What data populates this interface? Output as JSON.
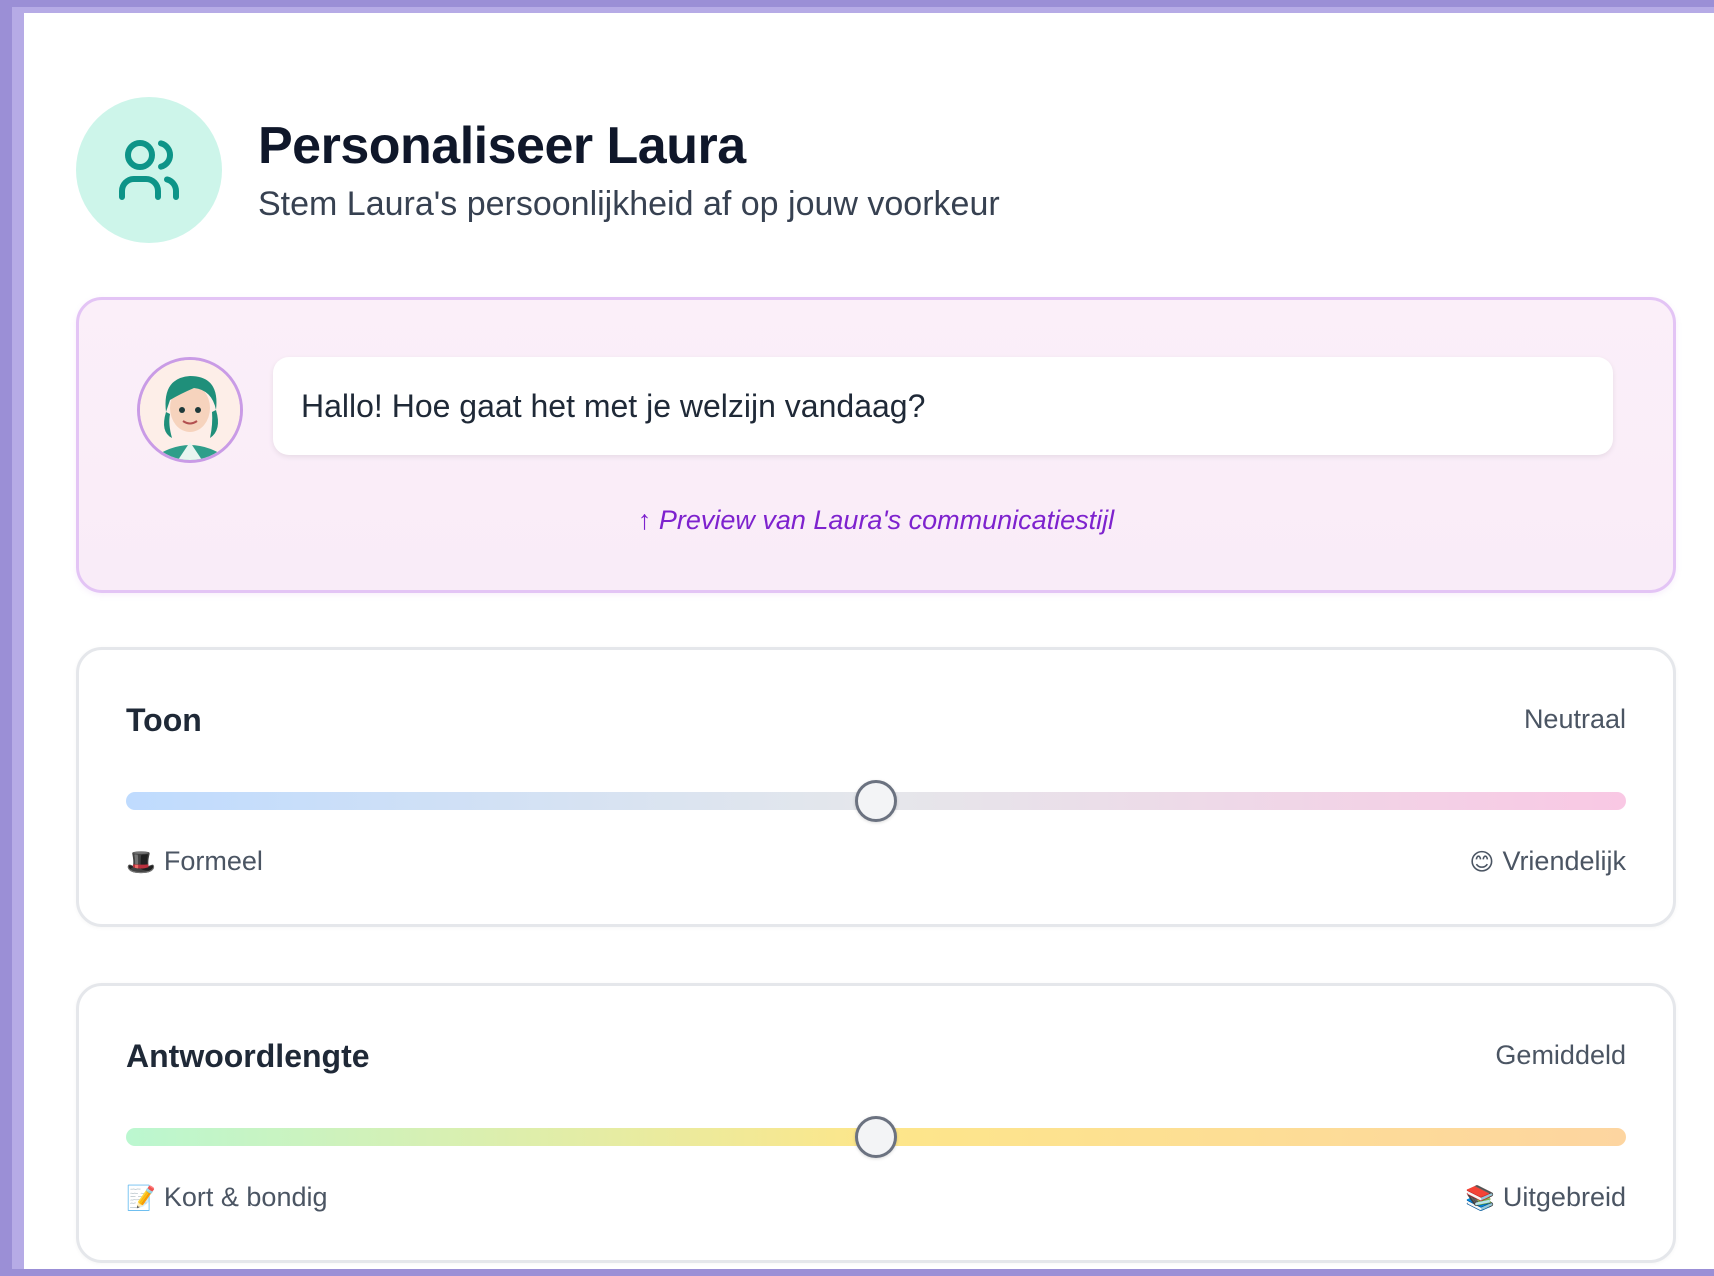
{
  "header": {
    "title": "Personaliseer Laura",
    "subtitle": "Stem Laura's persoonlijkheid af op jouw voorkeur",
    "icon": "users-icon"
  },
  "preview": {
    "message": "Hallo! Hoe gaat het met je welzijn vandaag?",
    "caption": "↑ Preview van Laura's communicatiestijl"
  },
  "sliders": [
    {
      "title": "Toon",
      "value_label": "Neutraal",
      "level": 0.5,
      "left_emoji": "🎩",
      "left_label": "Formeel",
      "right_emoji": "😊",
      "right_label": "Vriendelijk"
    },
    {
      "title": "Antwoordlengte",
      "value_label": "Gemiddeld",
      "level": 0.5,
      "left_emoji": "📝",
      "left_label": "Kort & bondig",
      "right_emoji": "📚",
      "right_label": "Uitgebreid"
    }
  ],
  "colors": {
    "accent": "#0d9488",
    "preview_caption": "#7e22ce",
    "page_border": "#9b8fd6"
  }
}
